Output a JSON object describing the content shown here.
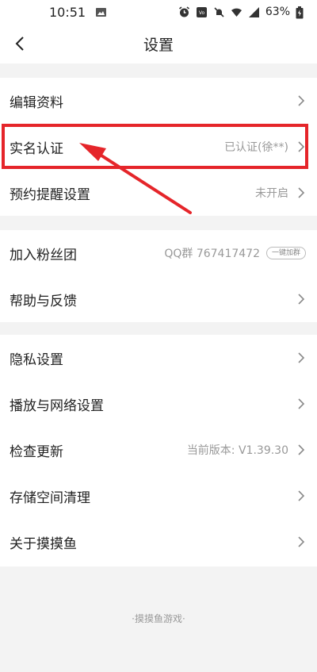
{
  "status_bar": {
    "time": "10:51",
    "battery": "63%",
    "network": "4G"
  },
  "header": {
    "title": "设置"
  },
  "sections": [
    {
      "items": [
        {
          "label": "编辑资料",
          "value": ""
        },
        {
          "label": "实名认证",
          "value": "已认证(徐**)"
        },
        {
          "label": "预约提醒设置",
          "value": "未开启"
        }
      ]
    },
    {
      "items": [
        {
          "label": "加入粉丝团",
          "value": "QQ群 767417472",
          "badge": "一键加群"
        },
        {
          "label": "帮助与反馈",
          "value": ""
        }
      ]
    },
    {
      "items": [
        {
          "label": "隐私设置",
          "value": ""
        },
        {
          "label": "播放与网络设置",
          "value": ""
        },
        {
          "label": "检查更新",
          "value": "当前版本: V1.39.30"
        },
        {
          "label": "存储空间清理",
          "value": ""
        },
        {
          "label": "关于摸摸鱼",
          "value": ""
        }
      ]
    }
  ],
  "footer": {
    "text": "·摸摸鱼游戏·"
  },
  "colors": {
    "highlight": "#e5252a",
    "background": "#f3f3f3"
  }
}
